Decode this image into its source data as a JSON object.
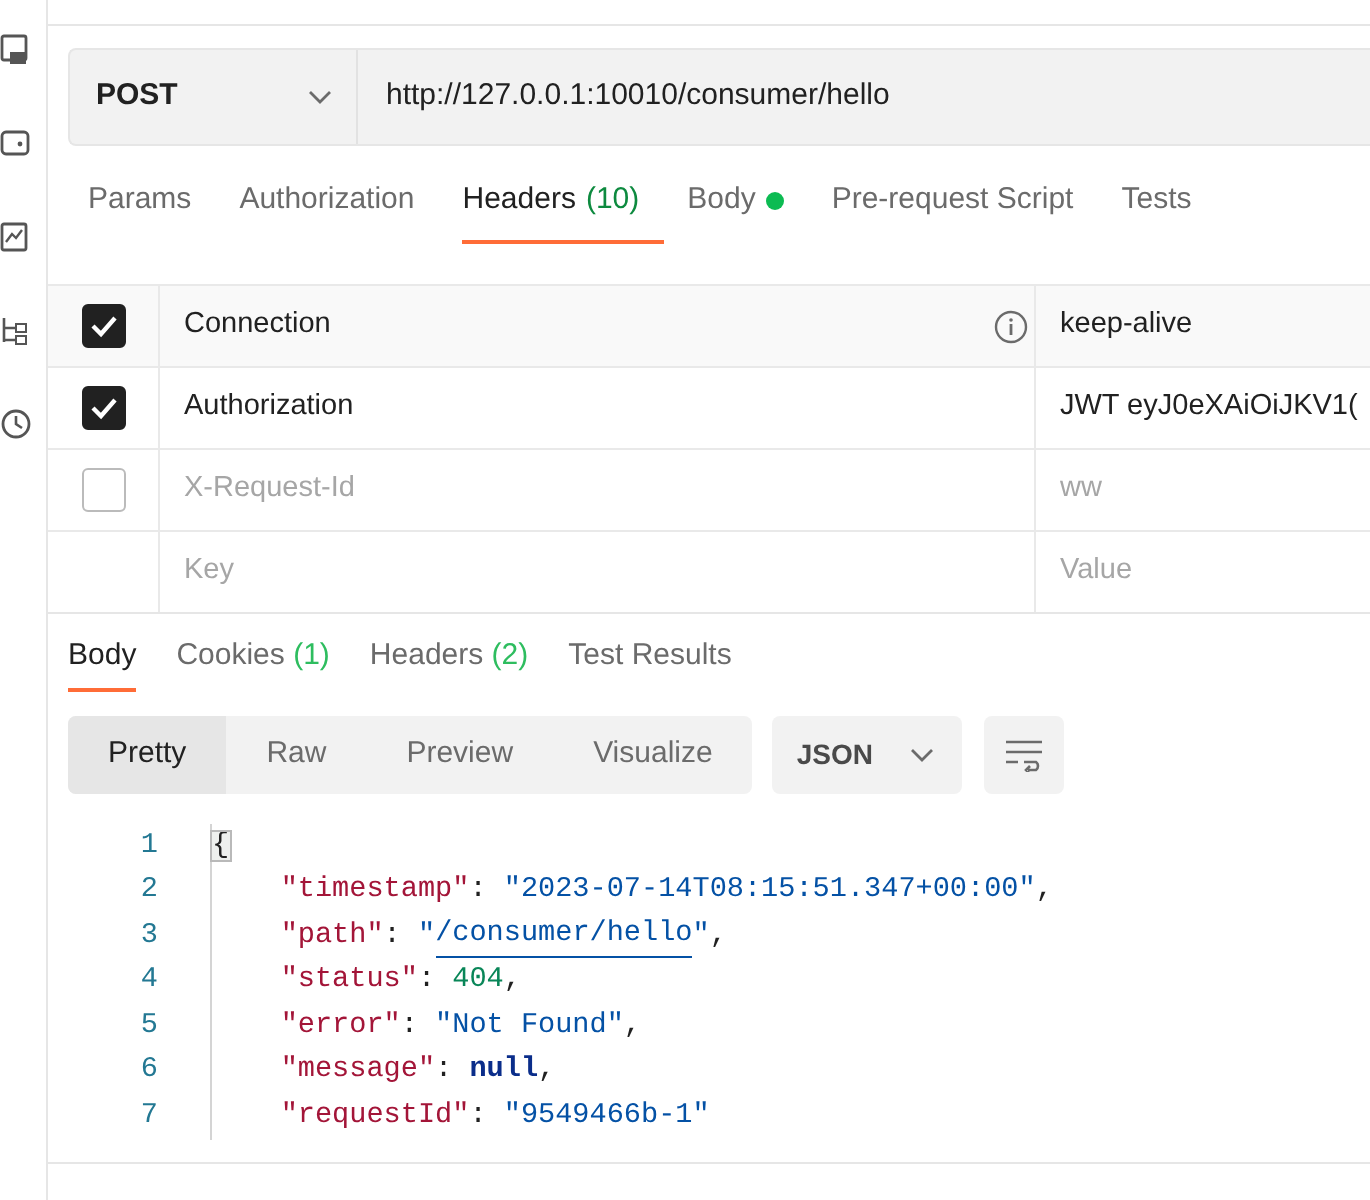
{
  "request": {
    "method": "POST",
    "url": "http://127.0.0.1:10010/consumer/hello"
  },
  "request_tabs": [
    {
      "label": "Params",
      "selected": false
    },
    {
      "label": "Authorization",
      "selected": false
    },
    {
      "label": "Headers",
      "count": "(10)",
      "selected": true
    },
    {
      "label": "Body",
      "has_content": true,
      "selected": false
    },
    {
      "label": "Pre-request Script",
      "selected": false
    },
    {
      "label": "Tests",
      "selected": false
    }
  ],
  "headers": {
    "rows": [
      {
        "checked": true,
        "key": "Connection",
        "value": "keep-alive",
        "info": true
      },
      {
        "checked": true,
        "key": "Authorization",
        "value": "JWT eyJ0eXAiOiJKV1("
      },
      {
        "checked": false,
        "key": "X-Request-Id",
        "value": "ww"
      }
    ],
    "new_row": {
      "key_placeholder": "Key",
      "value_placeholder": "Value"
    }
  },
  "response_tabs": [
    {
      "label": "Body",
      "selected": true
    },
    {
      "label": "Cookies",
      "count": "(1)",
      "selected": false
    },
    {
      "label": "Headers",
      "count": "(2)",
      "selected": false
    },
    {
      "label": "Test Results",
      "selected": false
    }
  ],
  "view_modes": [
    {
      "label": "Pretty",
      "selected": true
    },
    {
      "label": "Raw",
      "selected": false
    },
    {
      "label": "Preview",
      "selected": false
    },
    {
      "label": "Visualize",
      "selected": false
    }
  ],
  "format": "JSON",
  "code_lines": [
    {
      "number": "1",
      "tokens": [
        {
          "kind": "bracket",
          "text": "{"
        }
      ]
    },
    {
      "number": "2",
      "tokens": [
        {
          "kind": "space"
        },
        {
          "kind": "key",
          "text": "\"timestamp\""
        },
        {
          "kind": "punct",
          "text": ": "
        },
        {
          "kind": "string",
          "text": "\"2023-07-14T08:15:51.347+00:00\""
        },
        {
          "kind": "punct",
          "text": ","
        }
      ]
    },
    {
      "number": "3",
      "tokens": [
        {
          "kind": "space"
        },
        {
          "kind": "key",
          "text": "\"path\""
        },
        {
          "kind": "punct",
          "text": ": "
        },
        {
          "kind": "string",
          "text": "\""
        },
        {
          "kind": "link",
          "text": "/consumer/hello"
        },
        {
          "kind": "string",
          "text": "\""
        },
        {
          "kind": "punct",
          "text": ","
        }
      ]
    },
    {
      "number": "4",
      "tokens": [
        {
          "kind": "space"
        },
        {
          "kind": "key",
          "text": "\"status\""
        },
        {
          "kind": "punct",
          "text": ": "
        },
        {
          "kind": "number",
          "text": "404"
        },
        {
          "kind": "punct",
          "text": ","
        }
      ]
    },
    {
      "number": "5",
      "tokens": [
        {
          "kind": "space"
        },
        {
          "kind": "key",
          "text": "\"error\""
        },
        {
          "kind": "punct",
          "text": ": "
        },
        {
          "kind": "string",
          "text": "\"Not Found\""
        },
        {
          "kind": "punct",
          "text": ","
        }
      ]
    },
    {
      "number": "6",
      "tokens": [
        {
          "kind": "space"
        },
        {
          "kind": "key",
          "text": "\"message\""
        },
        {
          "kind": "punct",
          "text": ": "
        },
        {
          "kind": "keyword",
          "text": "null"
        },
        {
          "kind": "punct",
          "text": ","
        }
      ]
    },
    {
      "number": "7",
      "tokens": [
        {
          "kind": "space"
        },
        {
          "kind": "key",
          "text": "\"requestId\""
        },
        {
          "kind": "punct",
          "text": ": "
        },
        {
          "kind": "string",
          "text": "\"9549466b-1\""
        }
      ]
    }
  ]
}
